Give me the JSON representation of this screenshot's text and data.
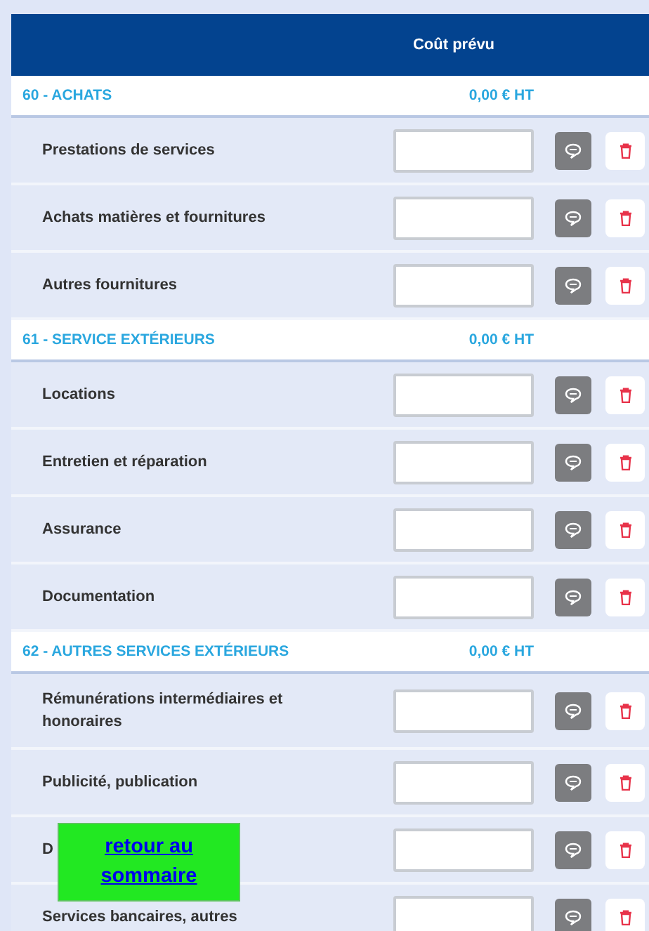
{
  "table": {
    "columns": [
      "Coût prévu"
    ],
    "sections": [
      {
        "title": "60 - ACHATS",
        "total": "0,00 € HT",
        "rows": [
          {
            "label": "Prestations de services"
          },
          {
            "label": "Achats matières et fournitures"
          },
          {
            "label": "Autres fournitures"
          }
        ]
      },
      {
        "title": "61 - SERVICE EXTÉRIEURS",
        "total": "0,00 € HT",
        "rows": [
          {
            "label": "Locations"
          },
          {
            "label": "Entretien et réparation"
          },
          {
            "label": "Assurance"
          },
          {
            "label": "Documentation"
          }
        ]
      },
      {
        "title": "62 - AUTRES SERVICES EXTÉRIEURS",
        "total": "0,00 € HT",
        "rows": [
          {
            "label": "Rémunérations intermédiaires et honoraires"
          },
          {
            "label": "Publicité, publication"
          },
          {
            "label": "D"
          },
          {
            "label": "Services bancaires, autres"
          }
        ]
      }
    ]
  },
  "overlay_link": {
    "label": "retour au sommaire"
  }
}
